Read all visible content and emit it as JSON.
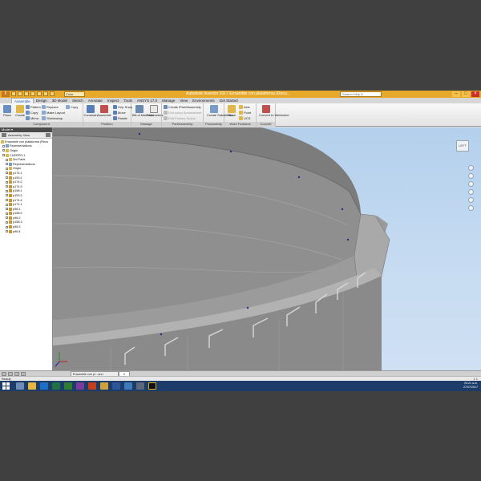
{
  "window": {
    "title": "Autodesk Inventor 2017   Ensamble con plataforma (Recu...",
    "search_placeholder": "Search Help & Commands...",
    "qat_select": "Color",
    "controls": [
      "–",
      "□",
      "×"
    ]
  },
  "ribbon_tabs": [
    "Assemble",
    "Design",
    "3D Model",
    "Sketch",
    "Annotate",
    "Inspect",
    "Tools",
    "ANSYS 17.0",
    "Manage",
    "View",
    "Environments",
    "Get Started"
  ],
  "ribbon": {
    "component": {
      "title": "Component",
      "place": "Place",
      "create": "Create",
      "pattern": "Pattern",
      "copy": "Copy",
      "mirror": "Mirror",
      "replace": "Replace",
      "make_layout": "Make Layout",
      "shrinkwrap": "Shrinkwrap",
      "copy2": "Copy"
    },
    "position": {
      "title": "Position",
      "constrain": "Constrain",
      "assemble": "Assemble",
      "grip_snap": "Grip Snap",
      "move": "Move",
      "rotate": "Rotate"
    },
    "manage": {
      "title": "Manage",
      "bom": "Bill of Materials",
      "parameters": "Parameters"
    },
    "partsassembly": {
      "title": "Part/Assembly",
      "create_part": "Create iPart/iAssembly",
      "edit_spreadsheet": "Edit using Spreadsheet",
      "edit_factory": "Edit Factory Scope"
    },
    "productivity": {
      "title": "Productivity",
      "create_substitutes": "Create Substitutes"
    },
    "work_features": {
      "title": "Work Features",
      "plane": "Plane",
      "axis": "Axis",
      "point": "Point",
      "ucs": "UCS"
    },
    "convert": {
      "title": "Convert",
      "convert_weldment": "Convert to Weldment"
    }
  },
  "browser": {
    "header": "Model ▾",
    "view_label": "Assembly View",
    "tree": [
      "Ensamble con plataforma (Recu",
      "Representations",
      "Origin",
      "CUERPO:1",
      "3rd Parts",
      "Representations",
      "Origin",
      "p174:1",
      "p153:1",
      "p174:2",
      "p174:3",
      "p158:1",
      "p153:2",
      "p174:4",
      "p171:1",
      "p96:1",
      "p158:2",
      "p96:2",
      "p158:3",
      "p96:3",
      "p96:4"
    ]
  },
  "viewport": {
    "viewcube_label": "LEFT"
  },
  "doc_tabs": {
    "active": "Ensamble con pl...ann",
    "second": "≡"
  },
  "status": {
    "text": "Ready",
    "counts": "1  1"
  },
  "taskbar": {
    "apps": [
      "file-explorer",
      "folder",
      "outlook",
      "excel",
      "project",
      "onenote",
      "powerpoint",
      "inventor",
      "word",
      "photos",
      "paint",
      "autodesk-a"
    ],
    "time": "00:21 a.m.",
    "date": "27/07/2017"
  },
  "colors": {
    "title_bar": "#e6a92a",
    "viewport_sky": "#c7dcf2",
    "model_gray": "#8d8d8d",
    "taskbar": "#1d3c6a"
  }
}
